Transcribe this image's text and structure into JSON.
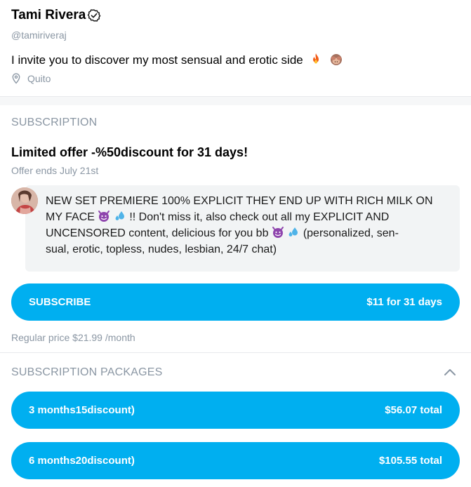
{
  "profile": {
    "name": "Tami Rivera",
    "handle": "@tamiriveraj",
    "bio": "I invite you to discover my most sensual and erotic side",
    "bio_icons": [
      "fire-emoji",
      "see-no-evil-monkey-emoji"
    ],
    "location": "Quito",
    "location_icon": "map-pin-icon",
    "verified_icon": "verified-badge-icon"
  },
  "subscription": {
    "section_title": "SUBSCRIPTION",
    "offer_title": "Limited offer -%50discount for 31 days!",
    "offer_ends": "Offer ends July 21st",
    "message": {
      "line1": "NEW SET PREMIERE 100% EXPLICIT THEY END UP WITH RICH MILK ON",
      "line2a": "MY FACE",
      "line2b": "!! Don't miss it, also check out all my EXPLICIT AND",
      "line3a": "UNCENSORED content, delicious for you bb",
      "line3b": "(personalized, sen-",
      "line4": "sual, erotic, topless, nudes, lesbian, 24/7 chat)",
      "icons": [
        "smiling-devil-emoji",
        "sweat-droplets-emoji"
      ]
    },
    "subscribe_button": {
      "label": "SUBSCRIBE",
      "price": "$11 for 31 days"
    },
    "regular_price": "Regular price $21.99 /month"
  },
  "packages": {
    "section_title": "SUBSCRIPTION PACKAGES",
    "toggle_icon": "chevron-up-icon",
    "items": [
      {
        "label": "3 months15discount)",
        "price": "$56.07 total"
      },
      {
        "label": "6 months20discount)",
        "price": "$105.55 total"
      }
    ]
  },
  "colors": {
    "accent": "#00aff0",
    "muted_text": "#8a96a3",
    "bubble_bg": "#f2f4f5"
  }
}
